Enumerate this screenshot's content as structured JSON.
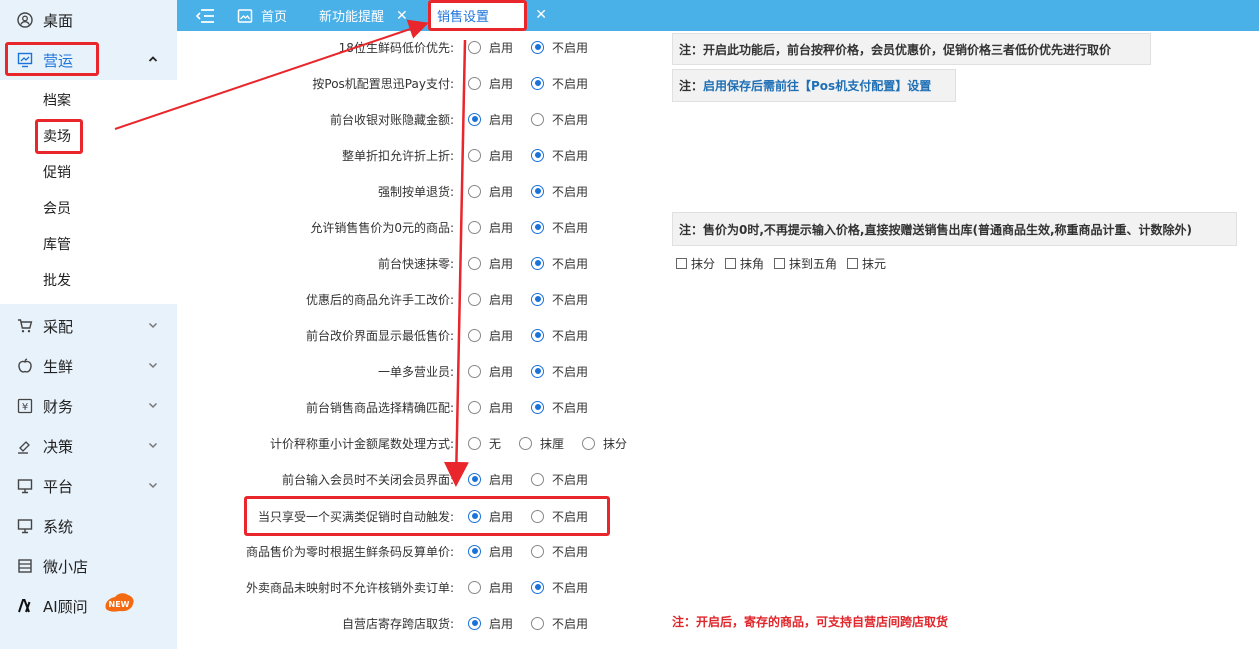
{
  "sidebar": {
    "items": [
      {
        "label": "桌面"
      },
      {
        "label": "营运"
      },
      {
        "label": "采配"
      },
      {
        "label": "生鲜"
      },
      {
        "label": "财务"
      },
      {
        "label": "决策"
      },
      {
        "label": "平台"
      },
      {
        "label": "系统"
      },
      {
        "label": "微小店"
      },
      {
        "label": "AI顾问",
        "badge": "NEW"
      }
    ],
    "submenu": [
      "档案",
      "卖场",
      "促销",
      "会员",
      "库管",
      "批发"
    ]
  },
  "tabs": [
    {
      "label": "首页"
    },
    {
      "label": "新功能提醒"
    },
    {
      "label": "销售设置"
    }
  ],
  "settings": [
    {
      "label": "18位生鲜码低价优先:",
      "options": [
        "启用",
        "不启用"
      ],
      "selected": 1
    },
    {
      "label": "按Pos机配置思迅Pay支付:",
      "options": [
        "启用",
        "不启用"
      ],
      "selected": 1
    },
    {
      "label": "前台收银对账隐藏金额:",
      "options": [
        "启用",
        "不启用"
      ],
      "selected": 0
    },
    {
      "label": "整单折扣允许折上折:",
      "options": [
        "启用",
        "不启用"
      ],
      "selected": 1
    },
    {
      "label": "强制按单退货:",
      "options": [
        "启用",
        "不启用"
      ],
      "selected": 1
    },
    {
      "label": "允许销售售价为0元的商品:",
      "options": [
        "启用",
        "不启用"
      ],
      "selected": 1
    },
    {
      "label": "前台快速抹零:",
      "options": [
        "启用",
        "不启用"
      ],
      "selected": 1
    },
    {
      "label": "优惠后的商品允许手工改价:",
      "options": [
        "启用",
        "不启用"
      ],
      "selected": 1
    },
    {
      "label": "前台改价界面显示最低售价:",
      "options": [
        "启用",
        "不启用"
      ],
      "selected": 1
    },
    {
      "label": "一单多营业员:",
      "options": [
        "启用",
        "不启用"
      ],
      "selected": 1
    },
    {
      "label": "前台销售商品选择精确匹配:",
      "options": [
        "启用",
        "不启用"
      ],
      "selected": 1
    },
    {
      "label": "计价秤称重小计金额尾数处理方式:",
      "options": [
        "无",
        "抹厘",
        "抹分"
      ],
      "selected": -1
    },
    {
      "label": "前台输入会员时不关闭会员界面:",
      "options": [
        "启用",
        "不启用"
      ],
      "selected": 0
    },
    {
      "label": "当只享受一个买满类促销时自动触发:",
      "options": [
        "启用",
        "不启用"
      ],
      "selected": 0
    },
    {
      "label": "商品售价为零时根据生鲜条码反算单价:",
      "options": [
        "启用",
        "不启用"
      ],
      "selected": 0
    },
    {
      "label": "外卖商品未映射时不允许核销外卖订单:",
      "options": [
        "启用",
        "不启用"
      ],
      "selected": 1
    },
    {
      "label": "自营店寄存跨店取货:",
      "options": [
        "启用",
        "不启用"
      ],
      "selected": 0
    }
  ],
  "notes": {
    "n1": "注：开启此功能后，前台按秤价格，会员优惠价，促销价格三者低价优先进行取价",
    "n2_prefix": "注：",
    "n2_link": "启用保存后需前往【Pos机支付配置】设置",
    "n3": "注：售价为0时,不再提示输入价格,直接按赠送销售出库(普通商品生效,称重商品计重、计数除外)",
    "n4": "注：开启后，寄存的商品，可支持自营店间跨店取货"
  },
  "rounding_checks": [
    "抹分",
    "抹角",
    "抹到五角",
    "抹元"
  ],
  "colors": {
    "accent": "#1a73d9",
    "tabbar": "#4ab0e8",
    "annotation": "#e8262b"
  }
}
